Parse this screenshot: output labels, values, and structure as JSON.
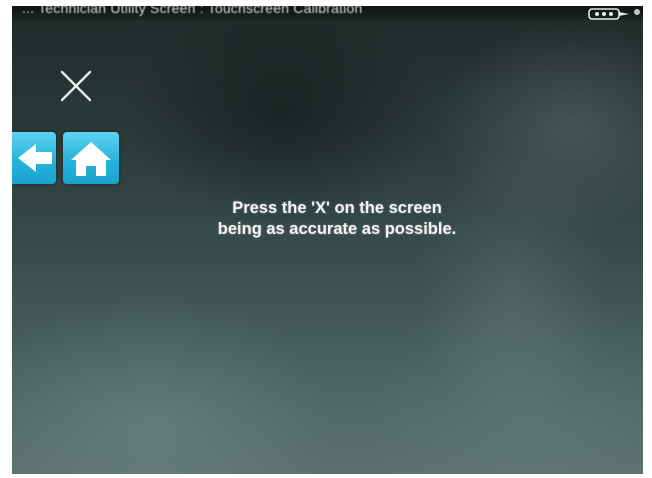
{
  "window": {
    "title": "... Technician Utility Screen : Touchscreen Calibration"
  },
  "status": {
    "battery_icon": "battery-icon",
    "indicator_icon": "status-dot-icon"
  },
  "calibration": {
    "target_icon": "close-x-icon",
    "instruction_line_1": "Press the 'X' on the screen",
    "instruction_line_2": "being as accurate as possible."
  },
  "nav": {
    "back_icon": "arrow-left-icon",
    "home_icon": "home-icon"
  },
  "colors": {
    "button_accent": "#26b4dd",
    "screen_background": "#3c5351",
    "text": "#f2f5f4"
  }
}
